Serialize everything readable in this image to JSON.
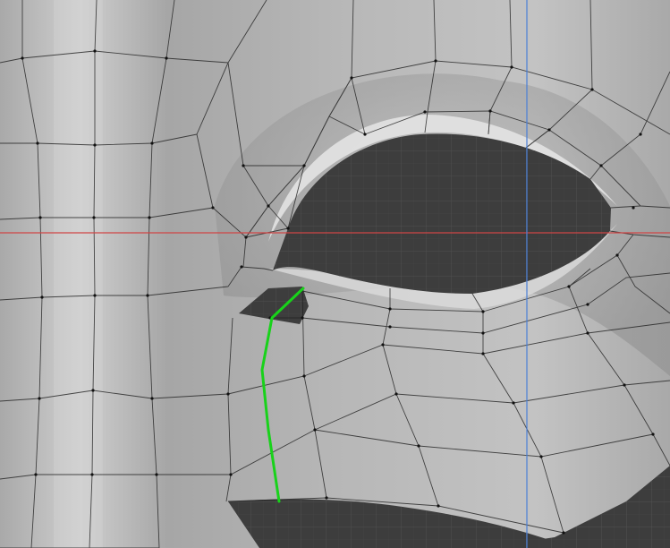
{
  "viewport": {
    "background_color": "#3d3d3d",
    "mesh_color": "#b9b9b9",
    "mesh_highlight_color": "#e6e6e6",
    "wire_color": "#222222",
    "vertex_color": "#111111",
    "grid_color": "#555555",
    "x_axis_color": "#d04545",
    "y_axis_color": "#4a7fd6",
    "selected_edge_color": "#18d21a"
  }
}
